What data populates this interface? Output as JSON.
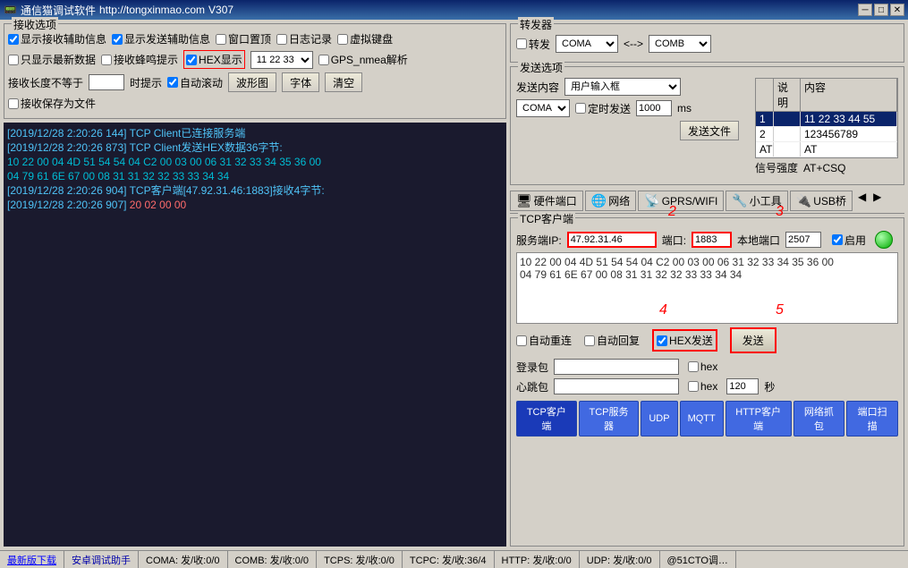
{
  "window": {
    "title": "通信猫调试软件",
    "url": "http://tongxinmao.com",
    "version": "V307",
    "minimize": "─",
    "maximize": "□",
    "close": "✕"
  },
  "receive_options": {
    "title": "接收选项",
    "checkbox1": "显示接收辅助信息",
    "checkbox2": "显示发送辅助信息",
    "checkbox3": "窗口置顶",
    "checkbox4": "日志记录",
    "checkbox5": "虚拟键盘",
    "checkbox6": "只显示最新数据",
    "checkbox7": "接收蜂鸣提示",
    "checkbox8": "HEX显示",
    "hex_value": "11 22 33",
    "checkbox9": "GPS_nmea解析",
    "label1": "接收长度不等于",
    "label2": "时提示",
    "checkbox10": "自动滚动",
    "btn_wave": "波形图",
    "btn_font": "字体",
    "btn_clear": "清空",
    "checkbox11": "接收保存为文件"
  },
  "log_lines": [
    {
      "time": "[2019/12/28 2:20:26 144]",
      "text": "  TCP Client已连接服务端"
    },
    {
      "time": "[2019/12/28 2:20:26 873]",
      "text": "  TCP Client发送HEX数据36字节:"
    },
    {
      "data1": "  10 22 00 04 4D 51 54 54 04 C2 00 03 00 06 31 32 33 34 35 36 00"
    },
    {
      "data2": "  04 79 61 6E 67 00 08 31 31 32 32 33 33 34 34"
    },
    {
      "time2": "[2019/12/28 2:20:26 904]",
      "text2": "  TCP客户端[47.92.31.46:1883]接收4字节:"
    },
    {
      "data3": "  20 02 00 00",
      "highlight": true
    }
  ],
  "forwarder": {
    "title": "转发器",
    "label_forward": "转发",
    "coma_label": "COMA",
    "arrow": "<-->",
    "comb_label": "COMB"
  },
  "send_options": {
    "title": "发送选项",
    "label_content": "发送内容",
    "dropdown_content": "用户输入框",
    "label_com": "COMA",
    "checkbox_timer": "定时发送",
    "timer_value": "1000",
    "label_ms": "ms",
    "btn_send_file": "发送文件",
    "table_title1": "说明",
    "table_title2": "内容",
    "row1_num": "1",
    "row1_content": "11 22 33 44 55",
    "row2_num": "2",
    "row2_content": "123456789",
    "row3_num": "AT",
    "row3_content": "AT",
    "label_signal": "信号强度",
    "signal_value": "AT+CSQ"
  },
  "icon_tabs": [
    {
      "icon": "🖥",
      "label": "硬件端口"
    },
    {
      "icon": "🌐",
      "label": "网络"
    },
    {
      "icon": "📡",
      "label": "GPRS/WIFI"
    },
    {
      "icon": "🔧",
      "label": "小工具"
    },
    {
      "icon": "🔌",
      "label": "USB桥"
    }
  ],
  "tcp_client": {
    "title": "TCP客户端",
    "label_ip": "服务端IP:",
    "ip_value": "47.92.31.46",
    "label_port": "端口:",
    "port_value": "1883",
    "label_local": "本地端口",
    "local_port": "2507",
    "checkbox_enable": "启用",
    "data_content": "10 22 00 04 4D 51 54 54 04 C2 00 03 00 06 31 32 33 34 35 36 00\n04 79 61 6E 67 00 08 31 31 32 32 33 33 34 34",
    "checkbox_auto_reconnect": "自动重连",
    "checkbox_auto_reply": "自动回复",
    "checkbox_hex_send": "HEX发送",
    "btn_send": "发送",
    "label_login": "登录包",
    "checkbox_login_hex": "hex",
    "label_heartbeat": "心跳包",
    "checkbox_heartbeat_hex": "hex",
    "heartbeat_time": "120",
    "label_seconds": "秒",
    "annotation2": "2",
    "annotation3": "3",
    "annotation4": "4",
    "annotation5": "5"
  },
  "bottom_tabs": [
    {
      "label": "TCP客户端",
      "active": true
    },
    {
      "label": "TCP服务器"
    },
    {
      "label": "UDP"
    },
    {
      "label": "MQTT"
    },
    {
      "label": "HTTP客户端"
    },
    {
      "label": "网络抓包"
    },
    {
      "label": "端口扫描"
    }
  ],
  "status_bar": [
    {
      "label": "最新版下载",
      "type": "link"
    },
    {
      "label": "安卓调试助手",
      "type": "link2"
    },
    {
      "label": "COMA: 发/收:0/0"
    },
    {
      "label": "COMB: 发/收:0/0"
    },
    {
      "label": "TCPS: 发/收:0/0"
    },
    {
      "label": "TCPC: 发/收:36/4"
    },
    {
      "label": "HTTP: 发/收:0/0"
    },
    {
      "label": "UDP: 发/收:0/0"
    },
    {
      "label": "@51CTO调…"
    }
  ]
}
